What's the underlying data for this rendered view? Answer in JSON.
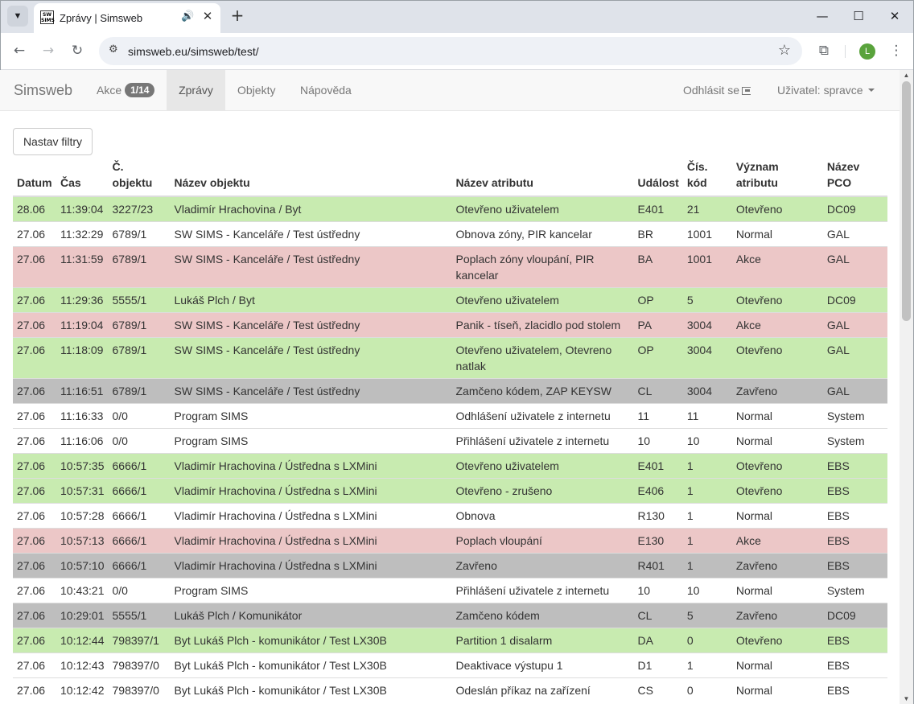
{
  "browser": {
    "tab_title": "Zprávy | Simsweb",
    "favicon_text": "SW SIMS",
    "url": "simsweb.eu/simsweb/test/",
    "profile_initial": "L"
  },
  "navbar": {
    "brand": "Simsweb",
    "items": [
      {
        "label": "Akce",
        "badge": "1/14"
      },
      {
        "label": "Zprávy"
      },
      {
        "label": "Objekty"
      },
      {
        "label": "Nápověda"
      }
    ],
    "logout": "Odhlásit se",
    "user": "Uživatel: spravce"
  },
  "filter_button": "Nastav filtry",
  "table": {
    "headers": [
      [
        "Datum"
      ],
      [
        "Čas"
      ],
      [
        "Č.",
        "objektu"
      ],
      [
        "Název objektu"
      ],
      [
        "Název atributu"
      ],
      [
        "Událost"
      ],
      [
        "Čís.",
        "kód"
      ],
      [
        "Význam",
        "atributu"
      ],
      [
        "Název",
        "PCO"
      ]
    ],
    "rows": [
      {
        "status": "ok",
        "cells": [
          "28.06",
          "11:39:04",
          "3227/23",
          "Vladimír Hrachovina / Byt",
          "Otevřeno uživatelem",
          "E401",
          "21",
          "Otevřeno",
          "DC09"
        ]
      },
      {
        "status": "plain",
        "cells": [
          "27.06",
          "11:32:29",
          "6789/1",
          "SW SIMS - Kanceláře / Test ústředny",
          "Obnova zóny, PIR kancelar",
          "BR",
          "1001",
          "Normal",
          "GAL"
        ]
      },
      {
        "status": "alarm",
        "cells": [
          "27.06",
          "11:31:59",
          "6789/1",
          "SW SIMS - Kanceláře / Test ústředny",
          "Poplach zóny vloupání, PIR kancelar",
          "BA",
          "1001",
          "Akce",
          "GAL"
        ]
      },
      {
        "status": "ok",
        "cells": [
          "27.06",
          "11:29:36",
          "5555/1",
          "Lukáš Plch / Byt",
          "Otevřeno uživatelem",
          "OP",
          "5",
          "Otevřeno",
          "DC09"
        ]
      },
      {
        "status": "alarm",
        "cells": [
          "27.06",
          "11:19:04",
          "6789/1",
          "SW SIMS - Kanceláře / Test ústředny",
          "Panik - tíseň, zlacidlo pod stolem",
          "PA",
          "3004",
          "Akce",
          "GAL"
        ]
      },
      {
        "status": "ok",
        "cells": [
          "27.06",
          "11:18:09",
          "6789/1",
          "SW SIMS - Kanceláře / Test ústředny",
          "Otevřeno uživatelem, Otevreno natlak",
          "OP",
          "3004",
          "Otevřeno",
          "GAL"
        ]
      },
      {
        "status": "closed",
        "cells": [
          "27.06",
          "11:16:51",
          "6789/1",
          "SW SIMS - Kanceláře / Test ústředny",
          "Zamčeno kódem, ZAP KEYSW",
          "CL",
          "3004",
          "Zavřeno",
          "GAL"
        ]
      },
      {
        "status": "plain",
        "cells": [
          "27.06",
          "11:16:33",
          "0/0",
          "Program SIMS",
          "Odhlášení uživatele z internetu",
          "11",
          "11",
          "Normal",
          "System"
        ]
      },
      {
        "status": "plain",
        "cells": [
          "27.06",
          "11:16:06",
          "0/0",
          "Program SIMS",
          "Přihlášení uživatele z internetu",
          "10",
          "10",
          "Normal",
          "System"
        ]
      },
      {
        "status": "ok",
        "cells": [
          "27.06",
          "10:57:35",
          "6666/1",
          "Vladimír Hrachovina / Ústředna s LXMini",
          "Otevřeno uživatelem",
          "E401",
          "1",
          "Otevřeno",
          "EBS"
        ]
      },
      {
        "status": "ok",
        "cells": [
          "27.06",
          "10:57:31",
          "6666/1",
          "Vladimír Hrachovina / Ústředna s LXMini",
          "Otevřeno - zrušeno",
          "E406",
          "1",
          "Otevřeno",
          "EBS"
        ]
      },
      {
        "status": "plain",
        "cells": [
          "27.06",
          "10:57:28",
          "6666/1",
          "Vladimír Hrachovina / Ústředna s LXMini",
          "Obnova",
          "R130",
          "1",
          "Normal",
          "EBS"
        ]
      },
      {
        "status": "alarm",
        "cells": [
          "27.06",
          "10:57:13",
          "6666/1",
          "Vladimír Hrachovina / Ústředna s LXMini",
          "Poplach vloupání",
          "E130",
          "1",
          "Akce",
          "EBS"
        ]
      },
      {
        "status": "closed",
        "cells": [
          "27.06",
          "10:57:10",
          "6666/1",
          "Vladimír Hrachovina / Ústředna s LXMini",
          "Zavřeno",
          "R401",
          "1",
          "Zavřeno",
          "EBS"
        ]
      },
      {
        "status": "plain",
        "cells": [
          "27.06",
          "10:43:21",
          "0/0",
          "Program SIMS",
          "Přihlášení uživatele z internetu",
          "10",
          "10",
          "Normal",
          "System"
        ]
      },
      {
        "status": "closed",
        "cells": [
          "27.06",
          "10:29:01",
          "5555/1",
          "Lukáš Plch / Komunikátor",
          "Zamčeno kódem",
          "CL",
          "5",
          "Zavřeno",
          "DC09"
        ]
      },
      {
        "status": "ok",
        "cells": [
          "27.06",
          "10:12:44",
          "798397/1",
          "Byt Lukáš Plch - komunikátor / Test LX30B",
          "Partition 1 disalarm",
          "DA",
          "0",
          "Otevřeno",
          "EBS"
        ]
      },
      {
        "status": "plain",
        "cells": [
          "27.06",
          "10:12:43",
          "798397/0",
          "Byt Lukáš Plch - komunikátor / Test LX30B",
          "Deaktivace výstupu 1",
          "D1",
          "1",
          "Normal",
          "EBS"
        ]
      },
      {
        "status": "plain",
        "cells": [
          "27.06",
          "10:12:42",
          "798397/0",
          "Byt Lukáš Plch - komunikátor / Test LX30B",
          "Odeslán příkaz na zařízení",
          "CS",
          "0",
          "Normal",
          "EBS"
        ]
      }
    ]
  },
  "colors": {
    "row_ok": "#c8ebb0",
    "row_alarm": "#ecc7c7",
    "row_closed": "#bebebe"
  }
}
